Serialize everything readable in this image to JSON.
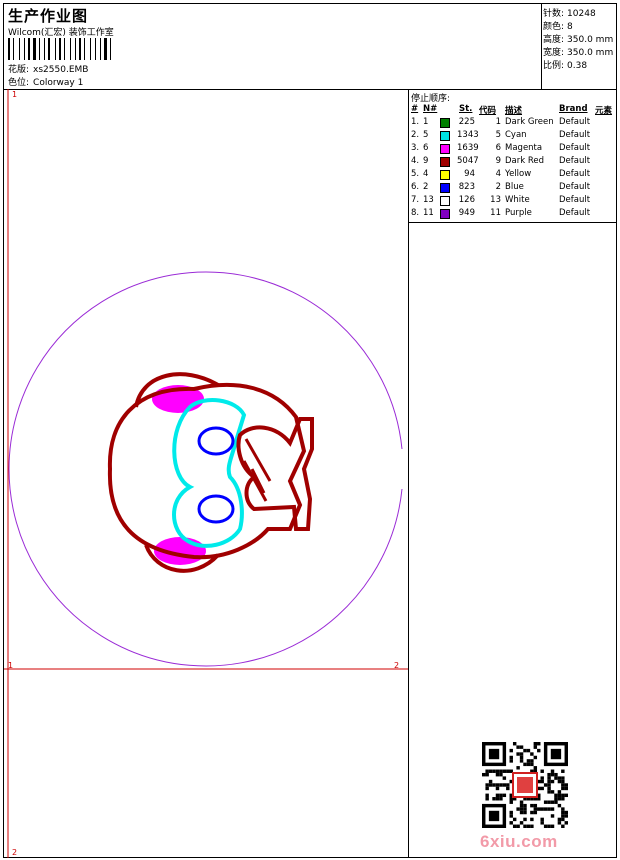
{
  "header": {
    "title": "生产作业图",
    "company": "Wilcom(汇宏) 装饰工作室",
    "design_label": "花版:",
    "design_value": "xs2550.EMB",
    "colorway_label": "色位:",
    "colorway_value": "Colorway 1"
  },
  "stats": {
    "stitches_label": "针数:",
    "stitches_value": "10248",
    "colors_label": "颜色:",
    "colors_value": "8",
    "height_label": "高度:",
    "height_value": "350.0 mm",
    "width_label": "宽度:",
    "width_value": "350.0 mm",
    "scale_label": "比例:",
    "scale_value": "0.38"
  },
  "sequence": {
    "title": "停止顺序:",
    "headers": {
      "num": "#",
      "n": "N#",
      "st": "St.",
      "code": "代码",
      "desc": "描述",
      "brand": "Brand",
      "elem": "元素"
    },
    "rows": [
      {
        "idx": "1.",
        "n": "1",
        "color": "#008000",
        "st": "225",
        "code": "1",
        "desc": "Dark Green",
        "brand": "Default"
      },
      {
        "idx": "2.",
        "n": "5",
        "color": "#00e5e5",
        "st": "1343",
        "code": "5",
        "desc": "Cyan",
        "brand": "Default"
      },
      {
        "idx": "3.",
        "n": "6",
        "color": "#ff00ff",
        "st": "1639",
        "code": "6",
        "desc": "Magenta",
        "brand": "Default"
      },
      {
        "idx": "4.",
        "n": "9",
        "color": "#a00000",
        "st": "5047",
        "code": "9",
        "desc": "Dark Red",
        "brand": "Default"
      },
      {
        "idx": "5.",
        "n": "4",
        "color": "#ffff00",
        "st": "94",
        "code": "4",
        "desc": "Yellow",
        "brand": "Default"
      },
      {
        "idx": "6.",
        "n": "2",
        "color": "#0000ff",
        "st": "823",
        "code": "2",
        "desc": "Blue",
        "brand": "Default"
      },
      {
        "idx": "7.",
        "n": "13",
        "color": "#ffffff",
        "st": "126",
        "code": "13",
        "desc": "White",
        "brand": "Default"
      },
      {
        "idx": "8.",
        "n": "11",
        "color": "#8000c0",
        "st": "949",
        "code": "11",
        "desc": "Purple",
        "brand": "Default"
      }
    ]
  },
  "guides": {
    "top_left": "1",
    "corner_left": "1",
    "corner_right": "2",
    "bottom_left": "2"
  },
  "colors": {
    "guide": "#d00000",
    "hoop": "#9a2bd6",
    "outline": "#a00000",
    "cyan": "#00eaea",
    "blue": "#0000ff",
    "magenta": "#ff00ff"
  },
  "watermark": "6xiu.com",
  "icons": [
    "qr-code",
    "seal-stamp"
  ]
}
